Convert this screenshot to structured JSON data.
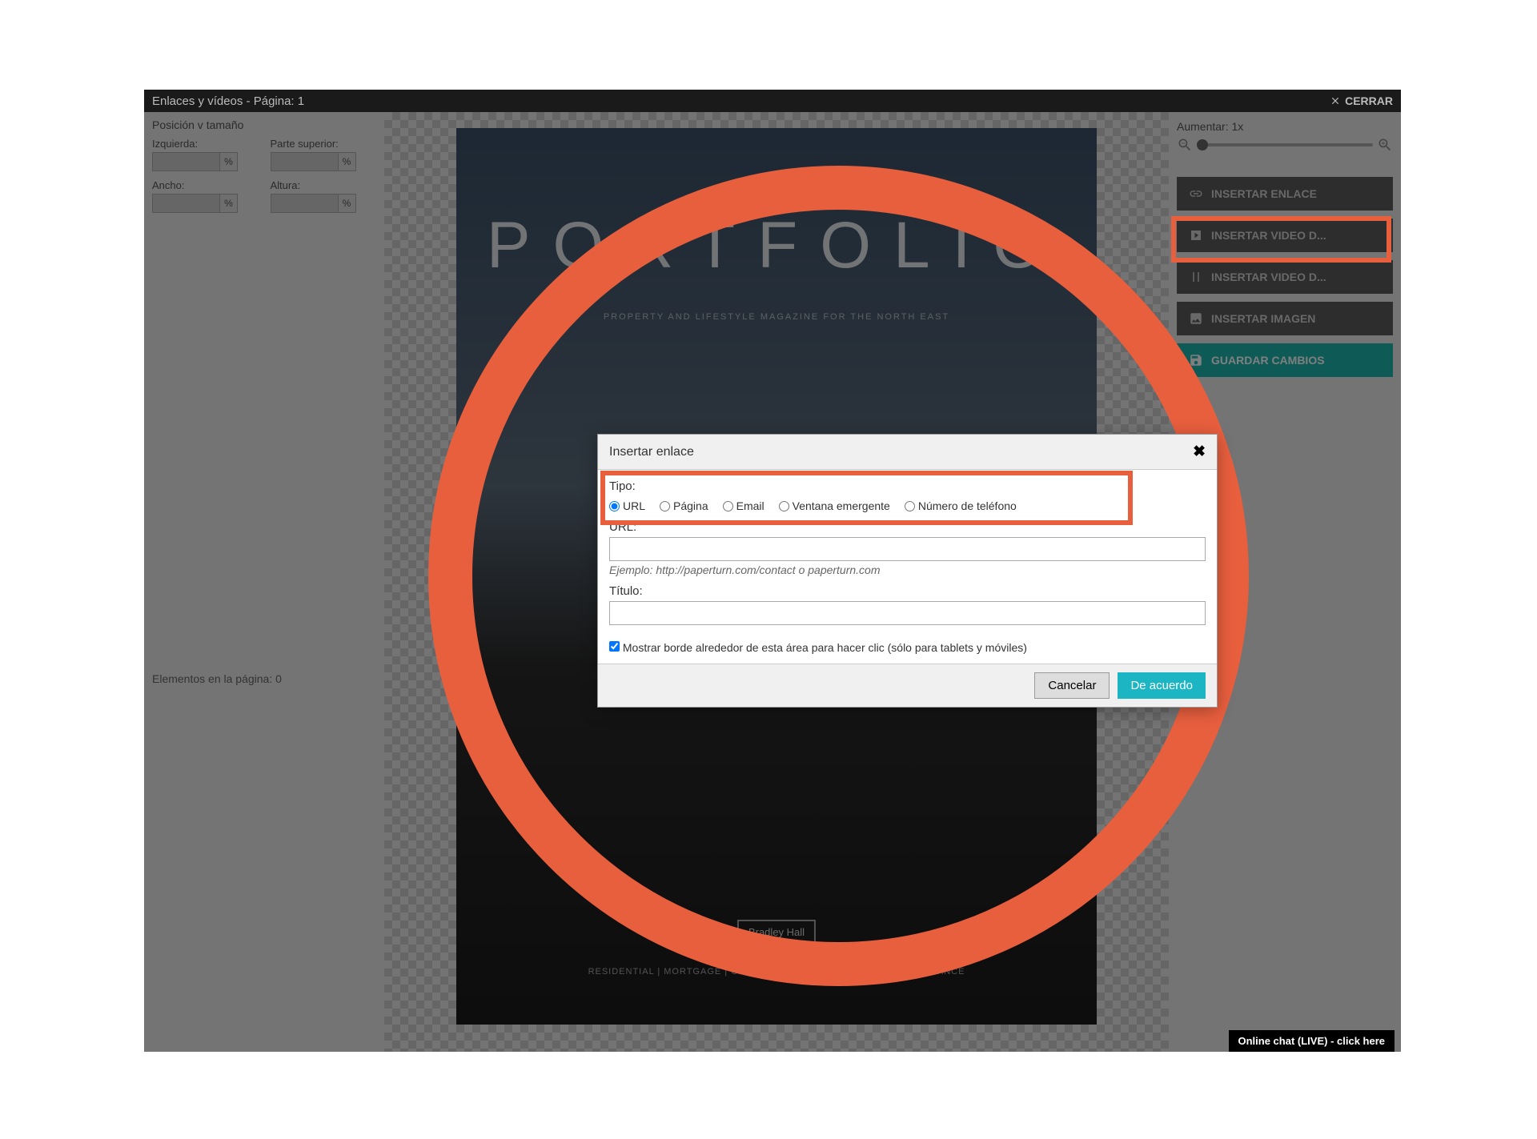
{
  "header": {
    "title": "Enlaces y vídeos - Página: 1",
    "close_label": "CERRAR"
  },
  "left_panel": {
    "section_title": "Posición v tamaño",
    "fields": {
      "izquierda": "Izquierda:",
      "parte_superior": "Parte superior:",
      "ancho": "Ancho:",
      "altura": "Altura:"
    },
    "pct": "%",
    "elements_label": "Elementos en la página: 0"
  },
  "preview": {
    "title": "PORTFOLIO",
    "subtitle": "PROPERTY AND LIFESTYLE MAGAZINE FOR THE NORTH EAST",
    "brand": "Bradley Hall",
    "footer": "RESIDENTIAL | MORTGAGE | COMMERCIAL | PLANNING & DESIGN | FINANCE"
  },
  "right_panel": {
    "zoom_label": "Aumentar: 1x",
    "buttons": {
      "insert_link": "INSERTAR ENLACE",
      "insert_video1": "INSERTAR VIDEO D...",
      "insert_video2": "INSERTAR VIDEO D...",
      "insert_image": "INSERTAR IMAGEN",
      "save": "GUARDAR CAMBIOS"
    }
  },
  "dialog": {
    "title": "Insertar enlace",
    "tipo_label": "Tipo:",
    "radios": {
      "url": "URL",
      "pagina": "Página",
      "email": "Email",
      "ventana": "Ventana emergente",
      "telefono": "Número de teléfono"
    },
    "url_label": "URL:",
    "url_hint": "Ejemplo: http://paperturn.com/contact o paperturn.com",
    "titulo_label": "Título:",
    "checkbox_label": "Mostrar borde alrededor de esta área para hacer clic (sólo para tablets y móviles)",
    "cancel": "Cancelar",
    "ok": "De acuerdo"
  },
  "chat": {
    "label": "Online chat (LIVE) - click here"
  }
}
